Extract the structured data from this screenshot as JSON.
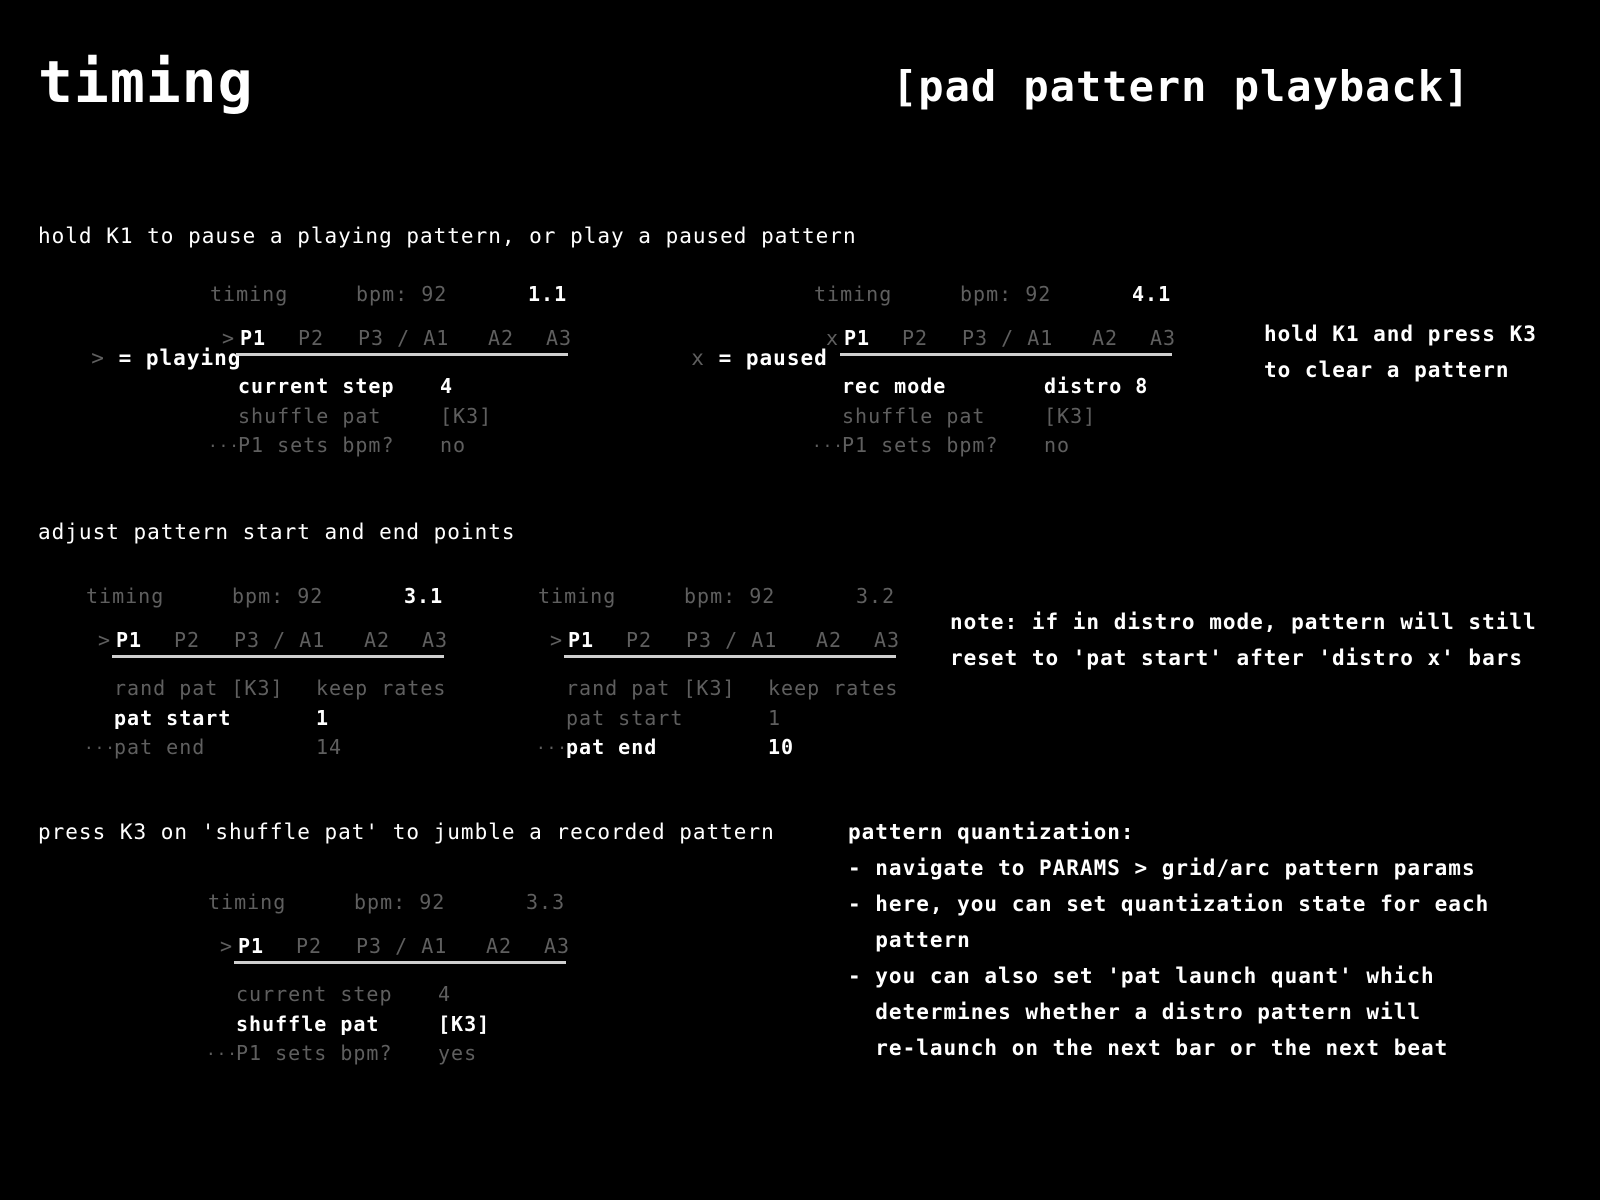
{
  "header": {
    "title": "timing",
    "subtitle": "[pad pattern playback]"
  },
  "sections": {
    "pause": {
      "desc": "hold K1 to pause a playing pattern, or play a paused pattern"
    },
    "adjust": {
      "desc": "adjust pattern start and end points"
    },
    "shuffle": {
      "desc": "press K3 on 'shuffle pat' to jumble a recorded pattern"
    }
  },
  "legend": {
    "playing_symbol": ">",
    "playing_label": "= playing",
    "paused_symbol": "x",
    "paused_label": "= paused"
  },
  "side_notes": {
    "clear_line1": "hold K1 and press K3",
    "clear_line2": "to clear a pattern",
    "distro_line1": "note: if in distro mode, pattern will still",
    "distro_line2": "reset to 'pat start' after 'distro x' bars"
  },
  "quant": {
    "title": "pattern quantization:",
    "b1": "- navigate to PARAMS > grid/arc pattern params",
    "b2a": "- here, you can set quantization state for each",
    "b2b": "  pattern",
    "b3a": "- you can also set 'pat launch quant' which",
    "b3b": "  determines whether a distro pattern will",
    "b3c": "  re-launch on the next bar or the next beat"
  },
  "screens": [
    {
      "id": "s1",
      "header": "timing",
      "bpm": "bpm: 92",
      "pos": "1.1",
      "marker": ">",
      "tabs": [
        "P1",
        "P2",
        "P3 / A1",
        "A2",
        "A3"
      ],
      "rows": [
        {
          "label": "current step",
          "value": "4",
          "selected": true
        },
        {
          "label": "shuffle pat",
          "value": "[K3]",
          "selected": false
        },
        {
          "label": "P1 sets bpm?",
          "value": "no",
          "selected": false
        }
      ],
      "dots": "..."
    },
    {
      "id": "s2",
      "header": "timing",
      "bpm": "bpm: 92",
      "pos": "4.1",
      "marker": "x",
      "tabs": [
        "P1",
        "P2",
        "P3 / A1",
        "A2",
        "A3"
      ],
      "rows": [
        {
          "label": "rec mode",
          "value": "distro 8",
          "selected": true
        },
        {
          "label": "shuffle pat",
          "value": "[K3]",
          "selected": false
        },
        {
          "label": "P1 sets bpm?",
          "value": "no",
          "selected": false
        }
      ],
      "dots": "..."
    },
    {
      "id": "s3",
      "header": "timing",
      "bpm": "bpm: 92",
      "pos": "3.1",
      "marker": ">",
      "tabs": [
        "P1",
        "P2",
        "P3 / A1",
        "A2",
        "A3"
      ],
      "rows": [
        {
          "label": "rand pat [K3]",
          "value": "keep rates",
          "selected": false
        },
        {
          "label": "pat start",
          "value": "1",
          "selected": true
        },
        {
          "label": "pat end",
          "value": "14",
          "selected": false
        }
      ],
      "dots": "..."
    },
    {
      "id": "s4",
      "header": "timing",
      "bpm": "bpm: 92",
      "pos": "3.2",
      "marker": ">",
      "tabs": [
        "P1",
        "P2",
        "P3 / A1",
        "A2",
        "A3"
      ],
      "rows": [
        {
          "label": "rand pat [K3]",
          "value": "keep rates",
          "selected": false
        },
        {
          "label": "pat start",
          "value": "1",
          "selected": false
        },
        {
          "label": "pat end",
          "value": "10",
          "selected": true
        }
      ],
      "dots": "..."
    },
    {
      "id": "s5",
      "header": "timing",
      "bpm": "bpm: 92",
      "pos": "3.3",
      "marker": ">",
      "tabs": [
        "P1",
        "P2",
        "P3 / A1",
        "A2",
        "A3"
      ],
      "rows": [
        {
          "label": "current step",
          "value": "4",
          "selected": false
        },
        {
          "label": "shuffle pat",
          "value": "[K3]",
          "selected": true
        },
        {
          "label": "P1 sets bpm?",
          "value": "yes",
          "selected": false
        }
      ],
      "dots": "..."
    }
  ]
}
